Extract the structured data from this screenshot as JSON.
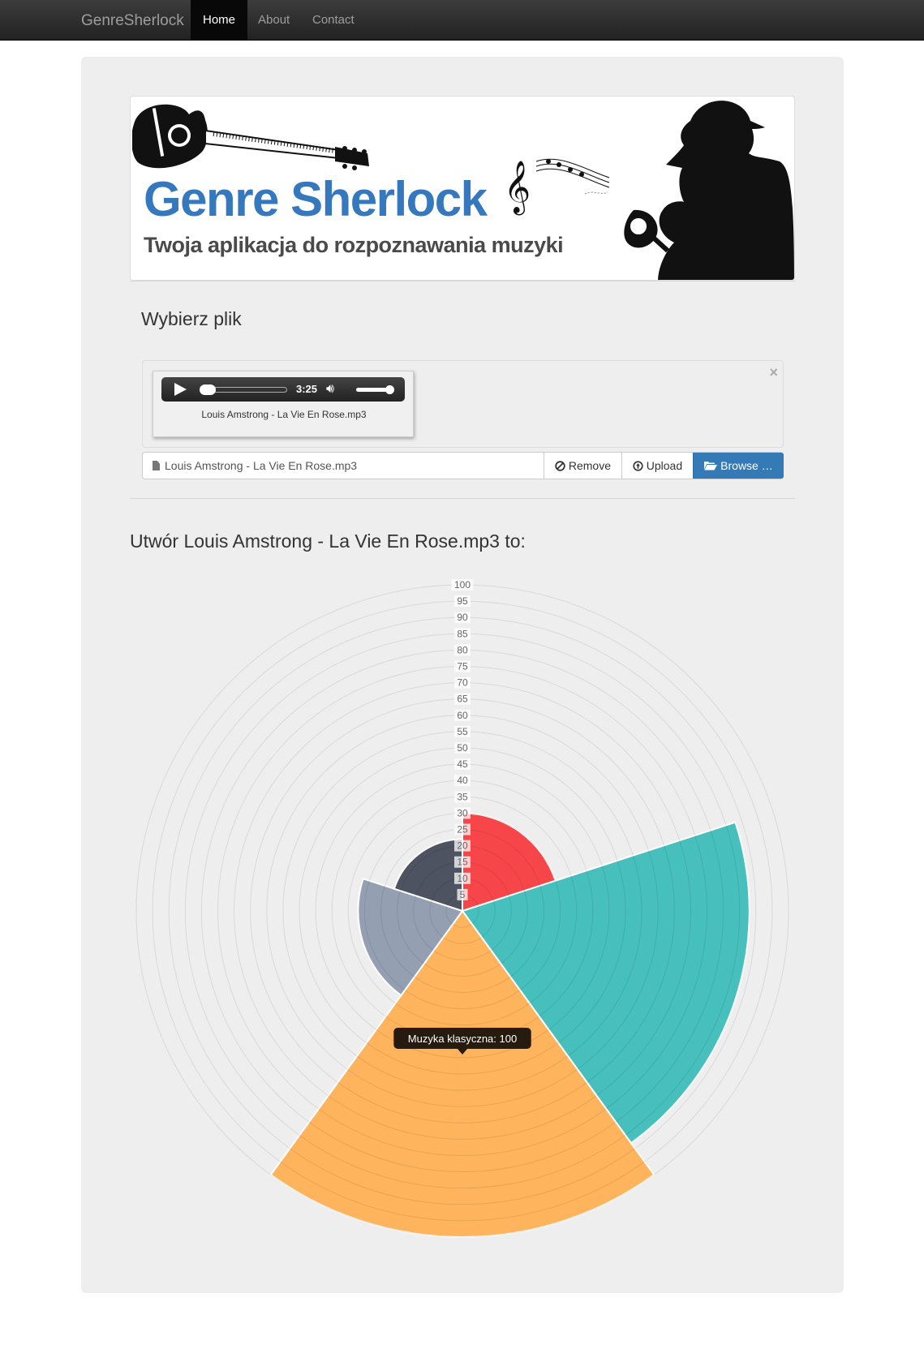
{
  "navbar": {
    "brand": "GenreSherlock",
    "links": [
      "Home",
      "About",
      "Contact"
    ],
    "active": "Home"
  },
  "banner": {
    "title": "Genre Sherlock",
    "subtitle": "Twoja aplikacja do rozpoznawania muzyki"
  },
  "upload": {
    "heading": "Wybierz plik",
    "player_time": "3:25",
    "preview_caption": "Louis Amstrong - La Vie En Rose.mp3",
    "file_name": "Louis Amstrong - La Vie En Rose.mp3",
    "remove_label": "Remove",
    "upload_label": "Upload",
    "browse_label": "Browse …",
    "close_symbol": "×"
  },
  "result": {
    "heading": "Utwór Louis Amstrong - La Vie En Rose.mp3 to:"
  },
  "chart_data": {
    "type": "polarArea",
    "rlim": [
      0,
      100
    ],
    "tick_step": 5,
    "tick_labels": [
      "5",
      "10",
      "15",
      "20",
      "25",
      "30",
      "35",
      "40",
      "45",
      "50",
      "55",
      "60",
      "65",
      "70",
      "75",
      "80",
      "85",
      "90",
      "95",
      "100"
    ],
    "slices": [
      {
        "value": 30,
        "color": "#f7464a"
      },
      {
        "value": 88,
        "color": "#46bfbd"
      },
      {
        "value": 100,
        "color": "#fdb45c",
        "label": "Muzyka klasyczna"
      },
      {
        "value": 32,
        "color": "#949fb1"
      },
      {
        "value": 22,
        "color": "#4d5360"
      }
    ],
    "tooltip": "Muzyka klasyczna: 100",
    "grid": true
  }
}
